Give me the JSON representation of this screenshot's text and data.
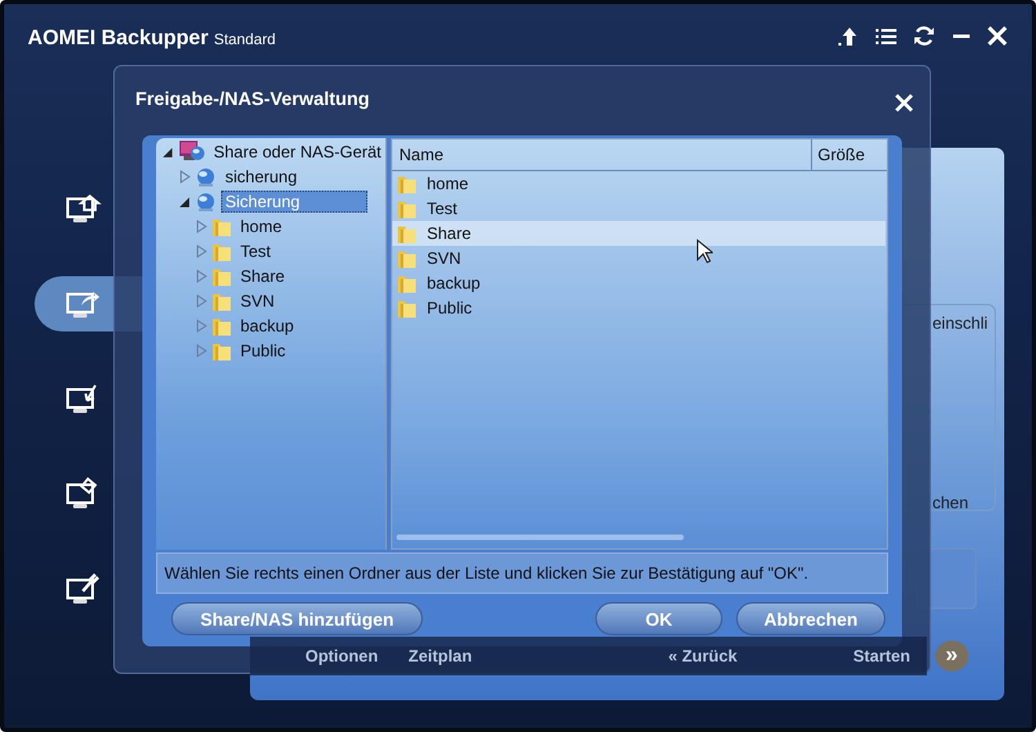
{
  "window": {
    "title": "AOMEI Backupper",
    "edition": "Standard"
  },
  "sidebar": {
    "items": [
      {
        "selected": false
      },
      {
        "selected": true
      },
      {
        "selected": false
      },
      {
        "selected": false
      },
      {
        "selected": false
      }
    ]
  },
  "background_panel": {
    "text_1": "einschli",
    "text_2": "chen",
    "toolbar": {
      "options": "Optionen",
      "schedule": "Zeitplan",
      "back": "« Zurück",
      "start": "Starten",
      "next": "»"
    }
  },
  "dialog": {
    "title": "Freigabe-/NAS-Verwaltung",
    "tree": {
      "label": "Share oder NAS-Gerät",
      "kind": "root",
      "expanded": true,
      "selected": false,
      "children": [
        {
          "label": "sicherung",
          "kind": "share",
          "expanded": false,
          "selected": false
        },
        {
          "label": "Sicherung",
          "kind": "share",
          "expanded": true,
          "selected": true,
          "children": [
            {
              "label": "home",
              "kind": "folder",
              "expanded": false,
              "selected": false
            },
            {
              "label": "Test",
              "kind": "folder",
              "expanded": false,
              "selected": false
            },
            {
              "label": "Share",
              "kind": "folder",
              "expanded": false,
              "selected": false
            },
            {
              "label": "SVN",
              "kind": "folder",
              "expanded": false,
              "selected": false
            },
            {
              "label": "backup",
              "kind": "folder",
              "expanded": false,
              "selected": false
            },
            {
              "label": "Public",
              "kind": "folder",
              "expanded": false,
              "selected": false
            }
          ]
        }
      ]
    },
    "list": {
      "columns": [
        "Name",
        "Größe"
      ],
      "rows": [
        {
          "name": "home",
          "selected": false
        },
        {
          "name": "Test",
          "selected": false
        },
        {
          "name": "Share",
          "selected": true
        },
        {
          "name": "SVN",
          "selected": false
        },
        {
          "name": "backup",
          "selected": false
        },
        {
          "name": "Public",
          "selected": false
        }
      ]
    },
    "message": "Wählen Sie rechts einen Ordner aus der Liste und klicken Sie zur Bestätigung auf \"OK\".",
    "buttons": {
      "add": "Share/NAS hinzufügen",
      "ok": "OK",
      "cancel": "Abbrechen"
    }
  }
}
